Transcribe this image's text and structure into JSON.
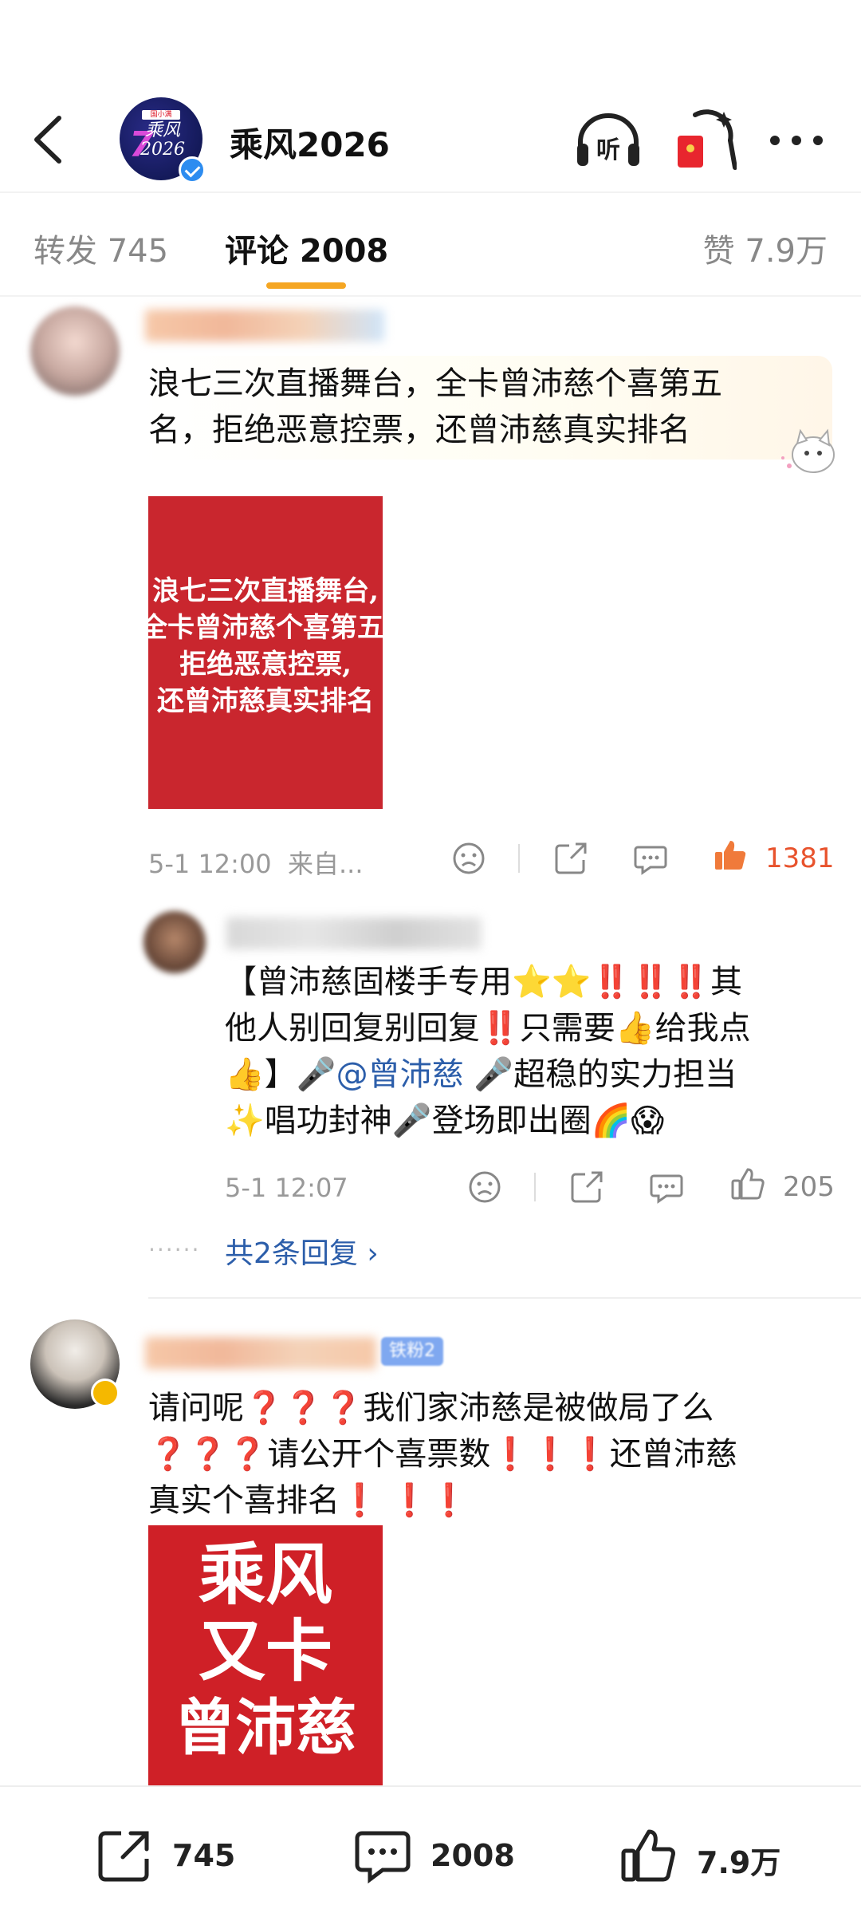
{
  "header": {
    "account_name": "乘风2026",
    "logo_tag": "国小满",
    "logo_line1": "乘风",
    "logo_line2": "2026"
  },
  "tabs": {
    "repost": "转发 745",
    "comment": "评论 2008",
    "like": "赞 7.9万"
  },
  "comments": [
    {
      "text_line1": "浪七三次直播舞台，全卡曾沛慈个喜第五",
      "text_line2": "名，拒绝恶意控票，还曾沛慈真实排名",
      "image_lines": [
        "浪七三次直播舞台,",
        "全卡曾沛慈个喜第五名",
        "拒绝恶意控票,",
        "还曾沛慈真实排名"
      ],
      "time": "5-1 12:00",
      "source": "来自...",
      "likes": "1381"
    },
    {
      "line1": "【曾沛慈固楼手专用⭐⭐‼️‼️‼️其",
      "line2": "他人别回复别回复‼️只需要👍给我点",
      "line3_a": "👍】🎤",
      "mention": "@曾沛慈",
      "line3_b": " 🎤超稳的实力担当",
      "line4": "✨唱功封神🎤登场即出圈🌈😱",
      "time": "5-1 12:07",
      "likes": "205",
      "replies_link": "共2条回复 ›",
      "replies_dots": "······"
    },
    {
      "badge": "铁粉2",
      "line1": "请问呢❓❓❓我们家沛慈是被做局了么",
      "line2": "❓❓❓请公开个喜票数❗❗❗还曾沛慈",
      "line3": "真实个喜排名❗ ❗❗",
      "image_lines": [
        "乘风",
        "又卡",
        "曾沛慈"
      ]
    }
  ],
  "bottom_bar": {
    "repost_count": "745",
    "comment_count": "2008",
    "like_count": "7.9万"
  },
  "colors": {
    "accent": "#f5a623",
    "like_hot": "#e8532d",
    "mention": "#2c5eaa",
    "verified": "#2d8cf0"
  }
}
